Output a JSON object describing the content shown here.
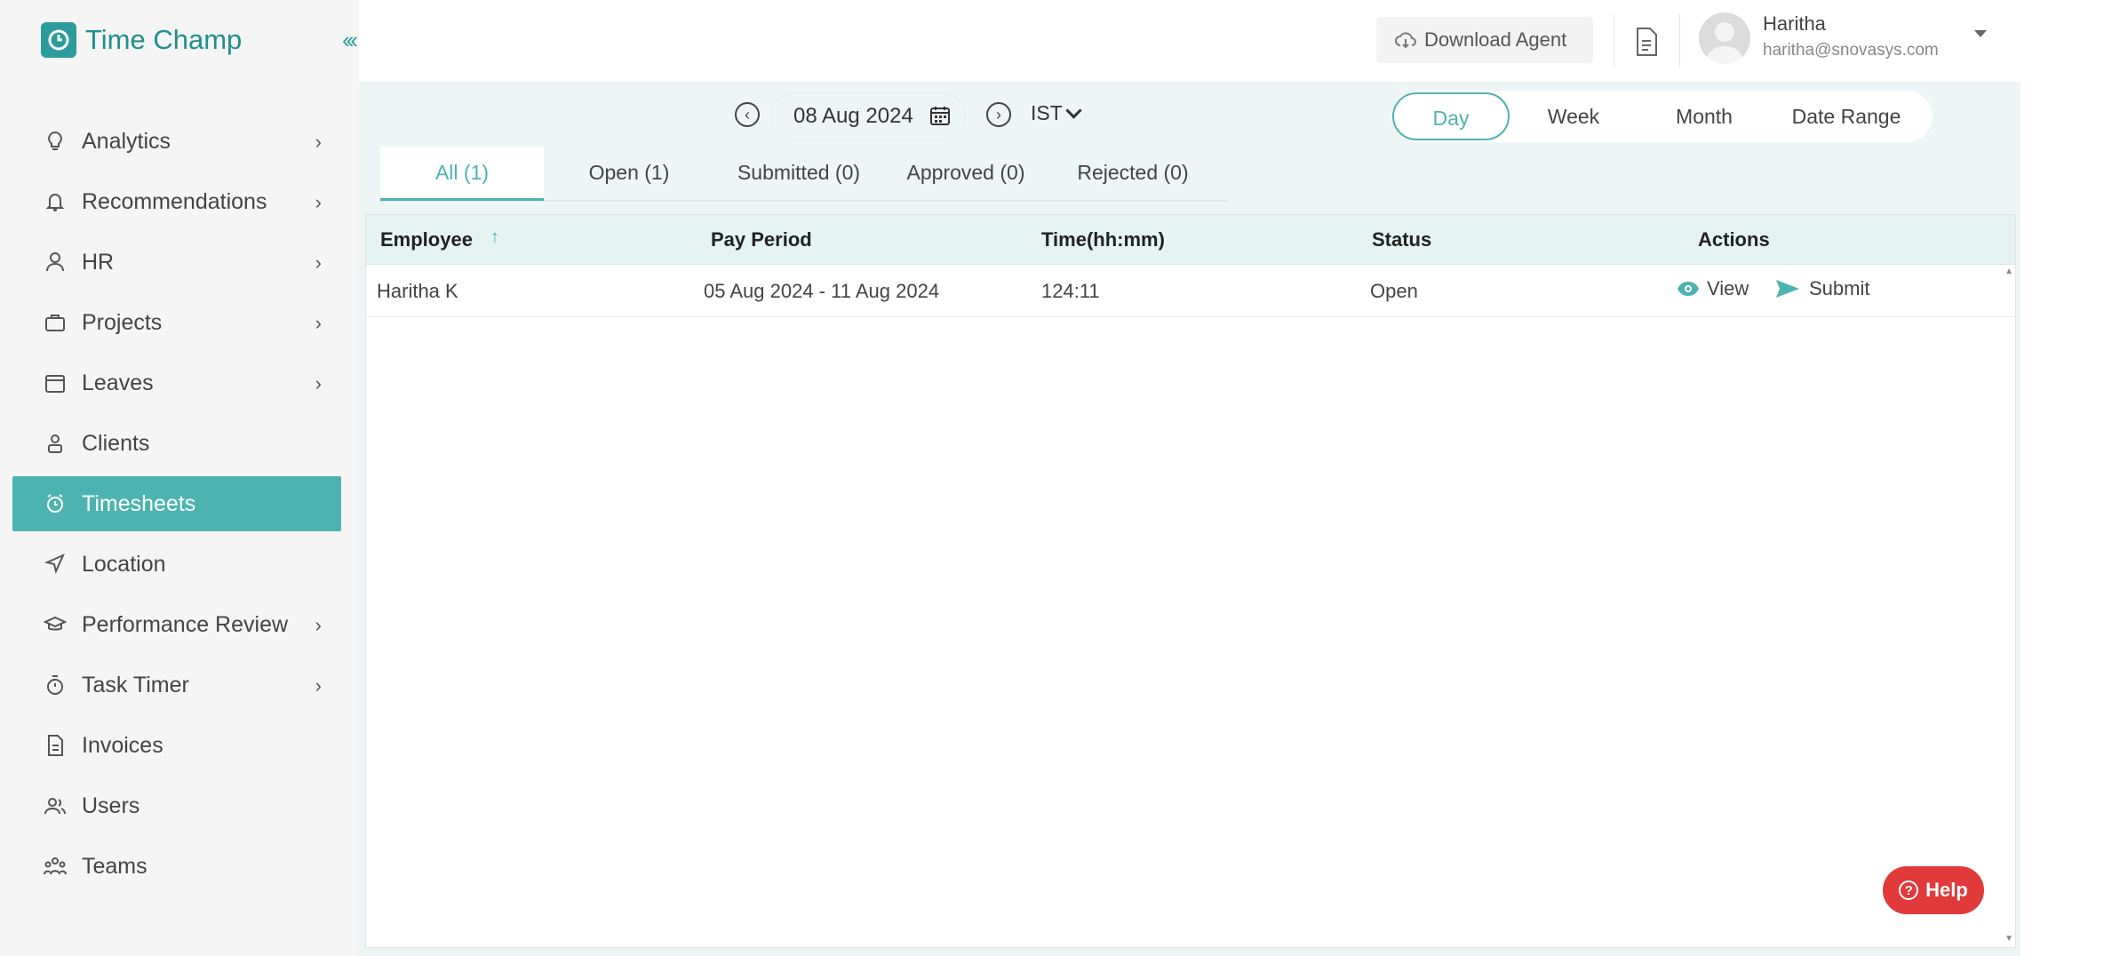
{
  "app": {
    "name": "Time Champ",
    "collapse_glyph": "«"
  },
  "sidebar": {
    "items": [
      {
        "label": "Analytics",
        "icon": "lightbulb-icon",
        "has_children": true
      },
      {
        "label": "Recommendations",
        "icon": "bell-icon",
        "has_children": true
      },
      {
        "label": "HR",
        "icon": "person-icon",
        "has_children": true
      },
      {
        "label": "Projects",
        "icon": "briefcase-icon",
        "has_children": true
      },
      {
        "label": "Leaves",
        "icon": "calendar-icon",
        "has_children": true
      },
      {
        "label": "Clients",
        "icon": "client-icon",
        "has_children": false
      },
      {
        "label": "Timesheets",
        "icon": "alarm-clock-icon",
        "has_children": false,
        "active": true
      },
      {
        "label": "Location",
        "icon": "navigation-icon",
        "has_children": false
      },
      {
        "label": "Performance Review",
        "icon": "graduation-cap-icon",
        "has_children": true
      },
      {
        "label": "Task Timer",
        "icon": "stopwatch-icon",
        "has_children": true
      },
      {
        "label": "Invoices",
        "icon": "invoice-icon",
        "has_children": false
      },
      {
        "label": "Users",
        "icon": "users-icon",
        "has_children": false
      },
      {
        "label": "Teams",
        "icon": "teams-icon",
        "has_children": false
      }
    ],
    "chevron": "›"
  },
  "header": {
    "download_label": "Download Agent",
    "user_name": "Haritha",
    "user_email": "haritha@snovasys.com"
  },
  "date_nav": {
    "prev": "‹",
    "next": "›",
    "date": "08 Aug 2024",
    "timezone": "IST"
  },
  "range_options": [
    {
      "label": "Day",
      "active": true
    },
    {
      "label": "Week",
      "active": false
    },
    {
      "label": "Month",
      "active": false
    },
    {
      "label": "Date Range",
      "active": false
    }
  ],
  "status_tabs": [
    {
      "label": "All (1)",
      "active": true
    },
    {
      "label": "Open (1)",
      "active": false
    },
    {
      "label": "Submitted (0)",
      "active": false
    },
    {
      "label": "Approved (0)",
      "active": false
    },
    {
      "label": "Rejected (0)",
      "active": false
    }
  ],
  "table": {
    "headers": [
      "Employee",
      "Pay Period",
      "Time(hh:mm)",
      "Status",
      "Actions"
    ],
    "sort_glyph": "↑",
    "rows": [
      {
        "employee": "Haritha K",
        "pay_period": "05 Aug 2024 - 11 Aug 2024",
        "time": "124:11",
        "status": "Open",
        "view_label": "View",
        "submit_label": "Submit"
      }
    ]
  },
  "help": {
    "label": "Help",
    "glyph": "?"
  },
  "colors": {
    "accent": "#4db3b0",
    "help": "#e03a3a",
    "brand": "#2a9d9b"
  }
}
